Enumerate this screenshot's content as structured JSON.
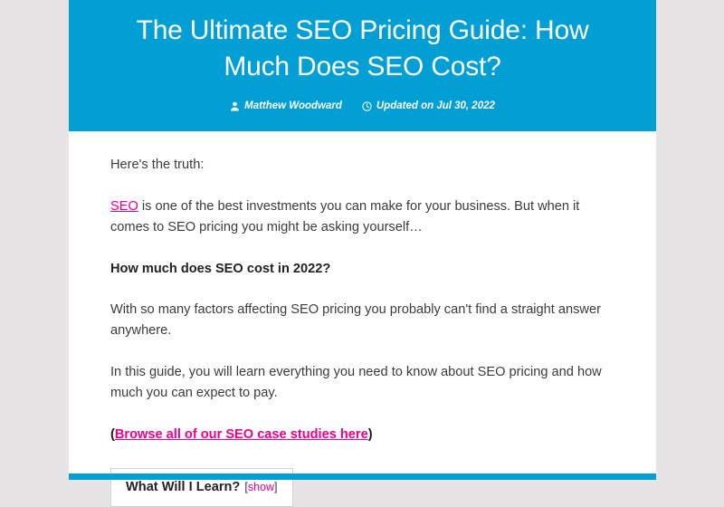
{
  "colors": {
    "header_blue": "#029FD5",
    "link_pink": "#EC008C",
    "page_background": "#e6e4e4",
    "body_text": "#3b3b3b"
  },
  "header": {
    "title": "The Ultimate SEO Pricing Guide: How Much Does SEO Cost?",
    "author_icon": "user-icon",
    "author": "Matthew Woodward",
    "updated_icon": "clock-icon",
    "updated": "Updated on Jul 30, 2022"
  },
  "body": {
    "paragraphs": [
      {
        "id": "intro",
        "type": "text",
        "text": "Here's the truth:"
      },
      {
        "id": "seo-investment",
        "type": "rich",
        "link_text": "SEO",
        "text": " is one of the best investments you can make for your business. But when it comes to SEO pricing you might be asking yourself…"
      },
      {
        "id": "cost-question",
        "type": "subhead",
        "text": "How much does SEO cost in 2022?"
      },
      {
        "id": "factors",
        "type": "text",
        "text": "With so many factors affecting SEO pricing you probably can't find a straight answer anywhere."
      },
      {
        "id": "guide-summary",
        "type": "text",
        "text": "In this guide, you will learn everything you need to know about SEO pricing and how much you can expect to pay."
      },
      {
        "id": "case-studies",
        "type": "link-para",
        "prefix": "(",
        "link_text": "Browse all of our SEO case studies here",
        "suffix": ")"
      }
    ]
  },
  "toc": {
    "title": "What Will I Learn?",
    "toggle_open_bracket": "[",
    "toggle_label": "show",
    "toggle_close_bracket": "]"
  }
}
